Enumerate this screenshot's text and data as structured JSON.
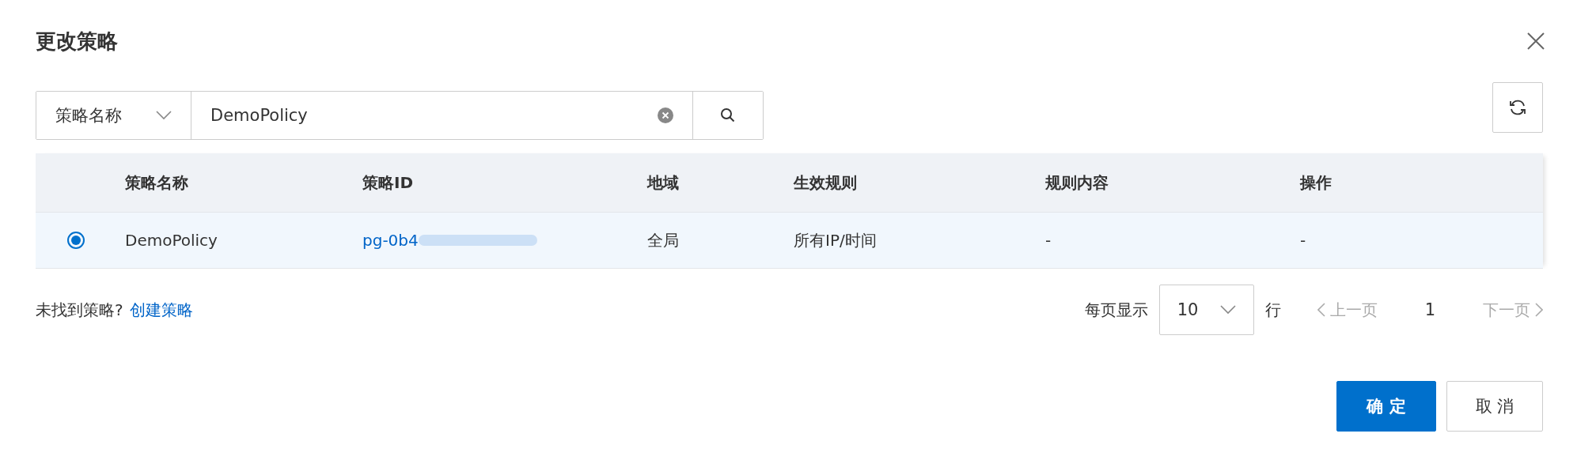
{
  "dialog": {
    "title": "更改策略"
  },
  "search": {
    "field": "策略名称",
    "value": "DemoPolicy"
  },
  "table": {
    "columns": [
      "策略名称",
      "策略ID",
      "地域",
      "生效规则",
      "规则内容",
      "操作"
    ],
    "rows": [
      {
        "selected": true,
        "cells": [
          "DemoPolicy",
          "pg-0b4",
          "全局",
          "所有IP/时间",
          "-",
          "-"
        ]
      }
    ]
  },
  "footer": {
    "hint": "未找到策略?",
    "link": "创建策略",
    "page_size_label": "每页显示",
    "page_size": "10",
    "page_size_unit": "行",
    "prev": "上一页",
    "page": "1",
    "next": "下一页"
  },
  "buttons": [
    {
      "label": "确 定",
      "kind": "primary"
    },
    {
      "label": "取 消",
      "kind": "secondary"
    }
  ]
}
